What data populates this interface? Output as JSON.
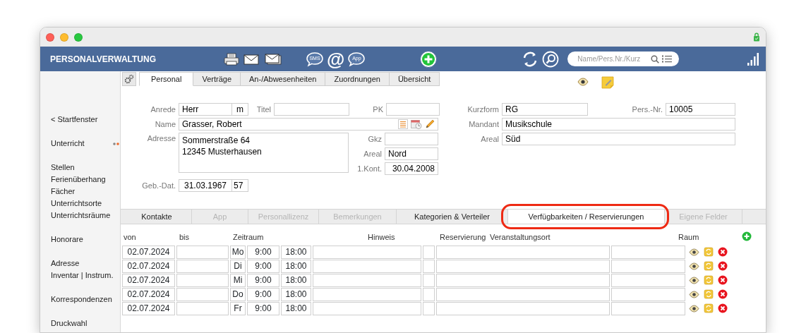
{
  "header": {
    "title": "PERSONALVERWALTUNG",
    "sms_label": "SMS",
    "at_sign": "@",
    "app_label": "App",
    "search": {
      "placeholder": "Name/Pers.Nr./Kurz"
    }
  },
  "sidebar": {
    "groups": [
      {
        "items": [
          {
            "label": "< Startfenster"
          }
        ]
      },
      {
        "items": [
          {
            "label": "Unterricht",
            "indicator": true
          }
        ]
      },
      {
        "items": [
          {
            "label": "Stellen"
          },
          {
            "label": "Ferienüberhang"
          },
          {
            "label": "Fächer"
          },
          {
            "label": "Unterrichtsorte"
          },
          {
            "label": "Unterrichtsräume"
          }
        ]
      },
      {
        "items": [
          {
            "label": "Honorare"
          }
        ]
      },
      {
        "items": [
          {
            "label": "Adresse"
          },
          {
            "label": "Inventar | Instrum."
          }
        ]
      },
      {
        "items": [
          {
            "label": "Korrespondenzen"
          }
        ]
      },
      {
        "items": [
          {
            "label": "Druckwahl"
          }
        ]
      }
    ]
  },
  "tabs": [
    {
      "label": "Personal",
      "selected": true
    },
    {
      "label": "Verträge",
      "selected": false
    },
    {
      "label": "An-/Abwesenheiten",
      "selected": false
    },
    {
      "label": "Zuordnungen",
      "selected": false
    },
    {
      "label": "Übersicht",
      "selected": false
    }
  ],
  "form": {
    "anrede": {
      "label": "Anrede",
      "value": "Herr",
      "gender": "m"
    },
    "titel": {
      "label": "Titel"
    },
    "pk": {
      "label": "PK"
    },
    "name": {
      "label": "Name",
      "value": "Grasser, Robert"
    },
    "adresse": {
      "label": "Adresse",
      "lines": [
        "Sommerstraße 64",
        "12345 Musterhausen"
      ]
    },
    "gkz": {
      "label": "Gkz"
    },
    "areal": {
      "label": "Areal",
      "value": "Nord"
    },
    "kontakt": {
      "label": "1.Kont.",
      "value": "30.04.2008"
    },
    "geburtsdatum": {
      "label": "Geb.-Dat.",
      "value": "31.03.1967",
      "age": "57"
    },
    "kurzform": {
      "label": "Kurzform",
      "value": "RG"
    },
    "pers_nr": {
      "label": "Pers.-Nr.",
      "value": "10005"
    },
    "mandant": {
      "label": "Mandant",
      "value": "Musikschule"
    },
    "areal_2": {
      "label": "Areal",
      "value": "Süd"
    }
  },
  "subtabs": [
    {
      "label": "Kontakte",
      "selected": false,
      "disabled": false
    },
    {
      "label": "App",
      "selected": false,
      "disabled": true
    },
    {
      "label": "Personallizenz",
      "selected": false,
      "disabled": true
    },
    {
      "label": "Bemerkungen",
      "selected": false,
      "disabled": true
    },
    {
      "label": "Kategorien & Verteiler",
      "selected": false,
      "disabled": false
    },
    {
      "label": "Verfügbarkeiten / Reservierungen",
      "selected": true,
      "disabled": false
    },
    {
      "label": "Eigene Felder",
      "selected": false,
      "disabled": true
    }
  ],
  "table": {
    "columns": [
      "von",
      "bis",
      "Zeitraum",
      "Hinweis",
      "Reservierung",
      "Veranstaltungsort",
      "Raum"
    ],
    "rows": [
      {
        "von": "02.07.2024",
        "day": "Mo",
        "start": "9:00",
        "end": "18:00"
      },
      {
        "von": "02.07.2024",
        "day": "Di",
        "start": "9:00",
        "end": "18:00"
      },
      {
        "von": "02.07.2024",
        "day": "Mi",
        "start": "9:00",
        "end": "18:00"
      },
      {
        "von": "02.07.2024",
        "day": "Do",
        "start": "9:00",
        "end": "18:00"
      },
      {
        "von": "02.07.2024",
        "day": "Fr",
        "start": "9:00",
        "end": "18:00"
      }
    ]
  }
}
